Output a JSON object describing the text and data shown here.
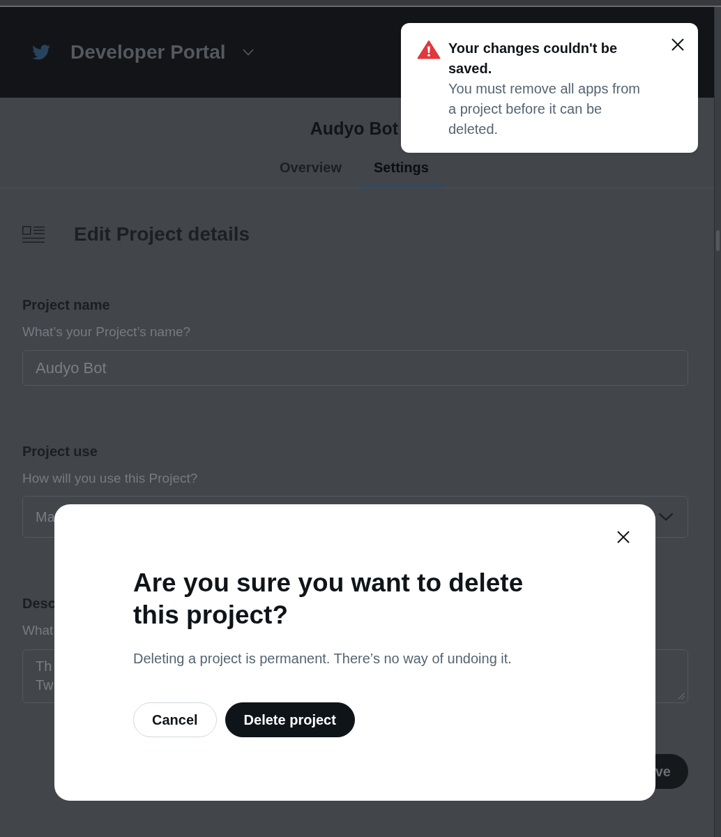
{
  "header": {
    "title": "Developer Portal"
  },
  "project": {
    "title": "Audyo Bot"
  },
  "tabs": [
    {
      "label": "Overview",
      "selected": false
    },
    {
      "label": "Settings",
      "selected": true
    }
  ],
  "section": {
    "title": "Edit Project details"
  },
  "fields": [
    {
      "kind": "input",
      "label": "Project name",
      "help": "What’s your Project’s name?",
      "value": "Audyo Bot"
    },
    {
      "kind": "select",
      "label": "Project use",
      "help": "How will you use this Project?",
      "value": "Ma"
    },
    {
      "kind": "textarea",
      "label": "Desc",
      "help": "What",
      "value": "Th\nTw"
    }
  ],
  "save_button": {
    "label": "ve"
  },
  "toast": {
    "title": "Your changes couldn't be saved.",
    "message": "You must remove all apps from a project before it can be deleted."
  },
  "modal": {
    "title": "Are you sure you want to delete this project?",
    "message": "Deleting a project is permanent. There’s no way of undoing it.",
    "buttons": [
      {
        "kind": "secondary",
        "label": "Cancel"
      },
      {
        "kind": "primary",
        "label": "Delete project"
      }
    ]
  }
}
